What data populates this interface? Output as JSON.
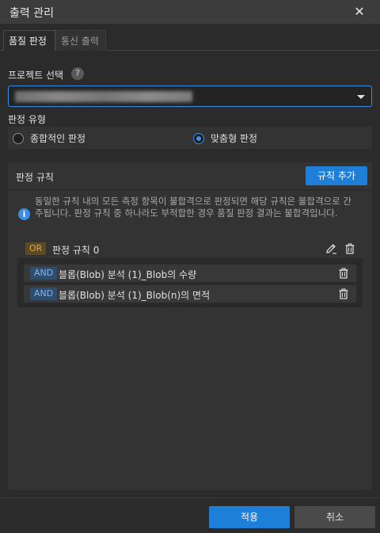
{
  "window": {
    "title": "출력 관리",
    "close_icon": "close-icon"
  },
  "tabs": [
    {
      "label": "품질 판정",
      "active": true
    },
    {
      "label": "통신 출력",
      "active": false
    }
  ],
  "project": {
    "label": "프로젝트 선택",
    "help_glyph": "?"
  },
  "judgement_type": {
    "label": "판정 유형",
    "options": [
      {
        "label": "종합적인 판정",
        "selected": false
      },
      {
        "label": "맞춤형 판정",
        "selected": true
      }
    ]
  },
  "rules": {
    "title": "판정 규칙",
    "add_button": "규칙 추가",
    "info_glyph": "i",
    "info_text": "동일한 규칙 내의 모든 측정 항목이 불합격으로 판정되면 해당 규칙은 불합격으로 간주됩니다. 판정 규칙 중 하나라도 부적합한 경우 품질 판정 결과는 불합격입니다.",
    "groups": [
      {
        "operator": "OR",
        "label": "판정 규칙 0",
        "conditions": [
          {
            "operator": "AND",
            "label": "블롭(Blob) 분석 (1)_Blob의 수량"
          },
          {
            "operator": "AND",
            "label": "블롭(Blob) 분석 (1)_Blob(n)의 면적"
          }
        ]
      }
    ]
  },
  "footer": {
    "apply": "적용",
    "cancel": "취소"
  },
  "colors": {
    "accent": "#1e7fd9",
    "or_badge": "#e6a64a",
    "and_badge": "#7fb8f0",
    "background": "#2b2b2b"
  }
}
